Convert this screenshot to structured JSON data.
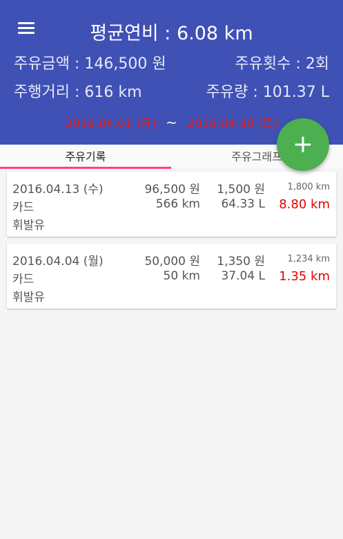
{
  "header": {
    "title": "평균연비 : 6.08 km",
    "fuel_amount": "주유금액 : 146,500 원",
    "fuel_count": "주유횟수 : 2회",
    "distance": "주행거리 : 616 km",
    "fuel_volume": "주유량 : 101.37 L",
    "start_date": "2016.04.01 (금)",
    "tilde": "~",
    "end_date": "2016.04.30 (토)"
  },
  "tabs": [
    {
      "label": "주유기록",
      "active": true
    },
    {
      "label": "주유그래프",
      "active": false
    }
  ],
  "fab": {
    "label": "+"
  },
  "records": [
    {
      "date": "2016.04.13 (수)",
      "amount": "96,500 원",
      "unit_price": "1,500 원",
      "odometer": "1,800 km",
      "payment": "카드",
      "distance": "566 km",
      "volume": "64.33 L",
      "efficiency": "8.80 km",
      "fuel_type": "휘발유"
    },
    {
      "date": "2016.04.04 (월)",
      "amount": "50,000 원",
      "unit_price": "1,350 원",
      "odometer": "1,234 km",
      "payment": "카드",
      "distance": "50 km",
      "volume": "37.04 L",
      "efficiency": "1.35 km",
      "fuel_type": "휘발유"
    }
  ],
  "colors": {
    "primary": "#3f51b5",
    "accent": "#ff4081",
    "fab": "#4caf50",
    "highlight": "#e50000"
  }
}
